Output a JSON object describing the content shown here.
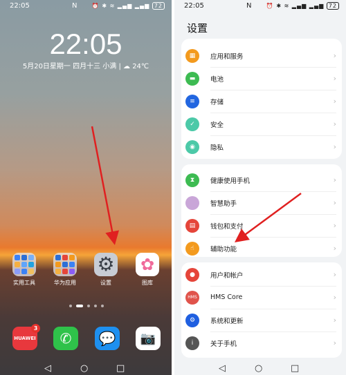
{
  "home": {
    "status": {
      "time": "22:05",
      "nfc": "N",
      "icons": "⏰ ✱ ≋ ▂▄▆ ▂▄▆",
      "battery": "72"
    },
    "clock": "22:05",
    "date": "5月20日星期一  四月十三  小满  |  ☁ 24℃",
    "apps": [
      {
        "label": "实用工具",
        "icon": "folder-icon"
      },
      {
        "label": "华为应用",
        "icon": "folder-icon"
      },
      {
        "label": "设置",
        "icon": "settings-gear-icon"
      },
      {
        "label": "图库",
        "icon": "gallery-icon"
      }
    ],
    "page_dots": {
      "count": 5,
      "active": 2
    },
    "dock": [
      {
        "label": "HUAWEI",
        "icon": "appgallery-icon",
        "badge": "3"
      },
      {
        "icon": "phone-icon"
      },
      {
        "icon": "messages-icon"
      },
      {
        "icon": "camera-icon"
      }
    ],
    "nav": {
      "back": "◁",
      "home": "○",
      "recent": "□"
    }
  },
  "settings": {
    "status": {
      "time": "22:05",
      "nfc": "N",
      "icons": "⏰ ✱ ≋ ▂▄▆ ▂▄▆",
      "battery": "72"
    },
    "title": "设置",
    "groups": [
      [
        {
          "label": "应用和服务",
          "color": "#f39a1e",
          "icon": "apps-icon",
          "glyph": "▦"
        },
        {
          "label": "电池",
          "color": "#3dbb52",
          "icon": "battery-icon",
          "glyph": "▬"
        },
        {
          "label": "存储",
          "color": "#2266e0",
          "icon": "storage-icon",
          "glyph": "≡"
        },
        {
          "label": "安全",
          "color": "#4cc9a8",
          "icon": "shield-icon",
          "glyph": "✓"
        },
        {
          "label": "隐私",
          "color": "#4cc9a8",
          "icon": "privacy-icon",
          "glyph": "◉"
        }
      ],
      [
        {
          "label": "健康使用手机",
          "color": "#3dbb52",
          "icon": "hourglass-icon",
          "glyph": "⧗"
        },
        {
          "label": "智慧助手",
          "color": "#c9a6d8",
          "icon": "assistant-icon",
          "glyph": ""
        },
        {
          "label": "钱包和支付",
          "color": "#e5453a",
          "icon": "wallet-icon",
          "glyph": "▤"
        },
        {
          "label": "辅助功能",
          "color": "#f39a1e",
          "icon": "accessibility-hand-icon",
          "glyph": "☝"
        }
      ],
      [
        {
          "label": "用户和帐户",
          "color": "#e5453a",
          "icon": "user-icon",
          "glyph": "●"
        },
        {
          "label": "HMS Core",
          "color": "#e0534b",
          "icon": "hms-icon",
          "glyph": "HMS"
        },
        {
          "label": "系统和更新",
          "color": "#1f5fe0",
          "icon": "system-update-icon",
          "glyph": "⚙"
        },
        {
          "label": "关于手机",
          "color": "#555555",
          "icon": "info-icon",
          "glyph": "i"
        }
      ]
    ],
    "chevron": "›",
    "nav": {
      "back": "◁",
      "home": "○",
      "recent": "□"
    }
  },
  "annotation_color": "#e02020"
}
